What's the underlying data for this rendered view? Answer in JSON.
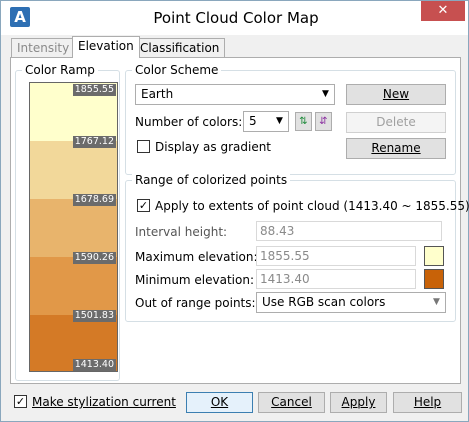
{
  "window": {
    "title": "Point Cloud Color Map",
    "app_icon": "A",
    "close": "✕"
  },
  "tabs": [
    {
      "label": "Intensity",
      "state": "disabled"
    },
    {
      "label": "Elevation",
      "state": "active"
    },
    {
      "label": "Classification",
      "state": "normal"
    }
  ],
  "color_ramp": {
    "title": "Color Ramp",
    "bands": [
      {
        "color": "#ffffcc",
        "label": "1855.55"
      },
      {
        "color": "#f2d89a",
        "label": "1767.12"
      },
      {
        "color": "#e8b46c",
        "label": "1678.69"
      },
      {
        "color": "#e19848",
        "label": "1590.26"
      },
      {
        "color": "#d47a26",
        "label": "1501.83"
      },
      {
        "color": "#c86208",
        "label": "1413.40"
      }
    ]
  },
  "color_scheme": {
    "title": "Color Scheme",
    "scheme_value": "Earth",
    "num_colors_label": "Number of colors:",
    "num_colors_value": "5",
    "display_gradient_label": "Display as gradient",
    "display_gradient_checked": "",
    "new_button": "New",
    "delete_button": "Delete",
    "rename_button": "Rename"
  },
  "range": {
    "title": "Range of colorized points",
    "apply_checked": "✓",
    "apply_label": "Apply to extents of point cloud  (1413.40 ~ 1855.55)",
    "interval_label": "Interval height:",
    "interval_value": "88.43",
    "max_label": "Maximum elevation:",
    "max_value": "1855.55",
    "max_color": "#ffffcc",
    "min_label": "Minimum elevation:",
    "min_value": "1413.40",
    "min_color": "#c86208",
    "out_of_range_label": "Out of range points:",
    "out_of_range_value": "Use RGB scan colors"
  },
  "footer": {
    "make_current_checked": "✓",
    "make_current_label": "Make stylization current",
    "ok": "OK",
    "cancel": "Cancel",
    "apply": "Apply",
    "help": "Help"
  }
}
